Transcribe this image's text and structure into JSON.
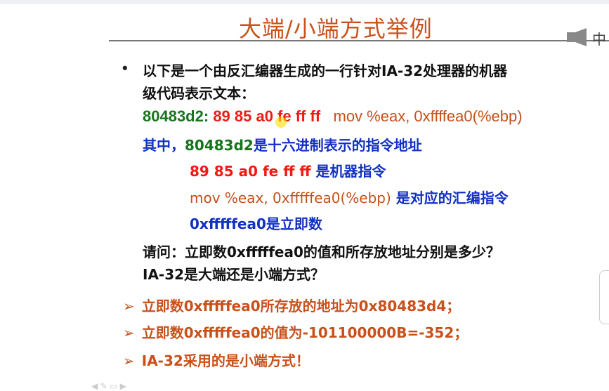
{
  "title": "大端/小端方式举例",
  "intro": [
    "以下是一个由反汇编器生成的一行针对IA-32处理器的机器",
    "级代码表示文本："
  ],
  "code": {
    "address": "80483d2:",
    "bytes": "89 85 a0 fe ff ff",
    "asm": "mov %eax, 0xffffea0(%ebp)"
  },
  "explain": {
    "l1_prefix": "其中，",
    "l1_addr": "80483d2",
    "l1_suffix": "是十六进制表示的指令地址",
    "l2_bytes": "89 85 a0 fe ff ff",
    "l2_suffix": " 是机器指令",
    "l3_asm": "mov %eax, 0xfffffea0(%ebp)",
    "l3_suffix": " 是对应的汇编指令",
    "l4": "0xfffffea0是立即数"
  },
  "question": [
    "请问：立即数0xfffffea0的值和所存放地址分别是多少？",
    "IA-32是大端还是小端方式？"
  ],
  "answers": [
    "立即数0xfffffea0所存放的地址为0x80483d4；",
    "立即数0xfffffea0的值为-101100000B=-352；",
    "IA-32采用的是小端方式！"
  ],
  "widget_label": "中"
}
